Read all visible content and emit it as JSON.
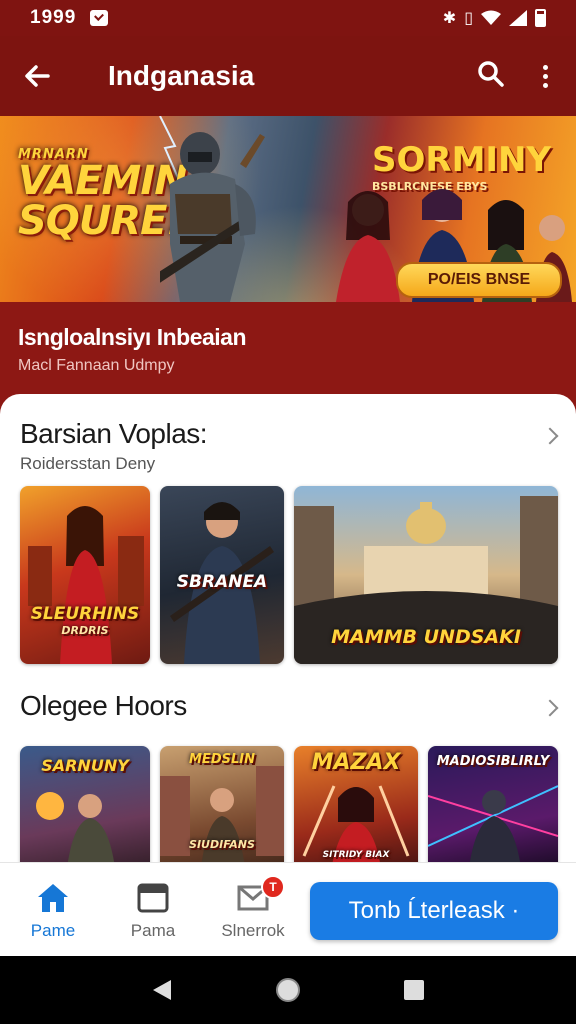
{
  "status_bar": {
    "time": "1999"
  },
  "app_bar": {
    "title": "Indganasia"
  },
  "hero": {
    "left_small": "MRNARN",
    "left_big_1": "VAEMIN",
    "left_big_2": "SQURE!",
    "right_big": "SORMINY",
    "right_small": "BSBLRCNESE EBYS",
    "badge": "PO/EIS BNSE"
  },
  "sub_header": {
    "title": "Isngloalnsiyı Inbeaian",
    "caption": "Macl Fannaan Udmpy"
  },
  "section1": {
    "title": "Barsian Voplas:",
    "subtitle": "Roidersstan Deny",
    "tiles": [
      {
        "caption": "SLEURHINS",
        "caption2": "DRDRIS"
      },
      {
        "caption": "SBRANEA",
        "caption2": ""
      },
      {
        "caption": "MAMMB UNDSAKI",
        "caption2": ""
      }
    ]
  },
  "section2": {
    "title": "Olegee Hoors",
    "tiles": [
      {
        "caption": "SARNUNY"
      },
      {
        "caption": "MEDSLIN",
        "caption2": "SIUDIFANS"
      },
      {
        "caption": "MAZAX",
        "caption2": "SITRIDY BIAX"
      },
      {
        "caption": "MADIOSIBLIRLY"
      }
    ]
  },
  "bottom_nav": {
    "items": [
      {
        "label": "Pame",
        "icon": "home-icon"
      },
      {
        "label": "Pama",
        "icon": "window-icon"
      },
      {
        "label": "Slnerrok",
        "icon": "mail-icon",
        "badge": "T"
      }
    ],
    "cta": "Tonb Ĺterleask ·"
  },
  "colors": {
    "primary": "#7d1410",
    "accent": "#1a7ce4",
    "badge": "#e0281e"
  }
}
